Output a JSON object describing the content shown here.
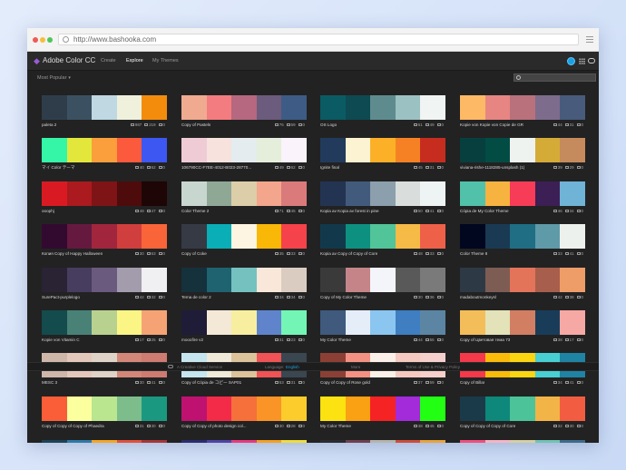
{
  "browser": {
    "url": "http://www.bashooka.com"
  },
  "app": {
    "title": "Adobe Color CC",
    "nav": [
      "Create",
      "Explore",
      "My Themes"
    ],
    "active_nav": "Explore",
    "sort_label": "Most Popular",
    "search_placeholder": ""
  },
  "footer": {
    "creative_cloud": "A Creative Cloud Service",
    "language_label": "Language:",
    "language_value": "English",
    "more": "More",
    "legal": "Terms of Use  &  Privacy Policy"
  },
  "themes": [
    {
      "name": "paleta 2",
      "views": "987",
      "likes": "219",
      "comments": "0",
      "colors": [
        "#2f3d4a",
        "#3b5162",
        "#bfd8e1",
        "#eff1dc",
        "#f38c0c"
      ]
    },
    {
      "name": "Copy of Pastels",
      "views": "76",
      "likes": "59",
      "comments": "0",
      "colors": [
        "#f0aa90",
        "#f37c80",
        "#b5687f",
        "#6b5b7c",
        "#3d5b85"
      ]
    },
    {
      "name": "OS Logo",
      "views": "61",
      "likes": "49",
      "comments": "0",
      "colors": [
        "#0a5b64",
        "#0e4a52",
        "#5e8c8e",
        "#9cc1c3",
        "#f0f4f2"
      ]
    },
    {
      "name": "Kopie von Kopie von Copie de GR",
      "views": "44",
      "likes": "31",
      "comments": "0",
      "colors": [
        "#fdb966",
        "#e78582",
        "#b9717c",
        "#7e6c8c",
        "#485b7d"
      ]
    },
    {
      "name": "マイ Color テーマ",
      "views": "40",
      "likes": "62",
      "comments": "0",
      "colors": [
        "#35f5a6",
        "#e3e73c",
        "#fb9f3c",
        "#fb5a3c",
        "#3d57f3"
      ]
    },
    {
      "name": "106790CC-F7EE-4012-B023-28770...",
      "views": "49",
      "likes": "62",
      "comments": "0",
      "colors": [
        "#efcbd6",
        "#f7e2dd",
        "#e4ecef",
        "#e5eedb",
        "#faf3fb"
      ]
    },
    {
      "name": "Ignite final",
      "views": "45",
      "likes": "31",
      "comments": "0",
      "colors": [
        "#223b5c",
        "#fbf3d1",
        "#fbb028",
        "#f68124",
        "#c62d1f"
      ]
    },
    {
      "name": "viviana-rishe-1118285-unsplash (1)",
      "views": "39",
      "likes": "29",
      "comments": "0",
      "colors": [
        "#073f3f",
        "#034c44",
        "#eef3ef",
        "#d5ab38",
        "#c58b5c"
      ]
    },
    {
      "name": "ooophj",
      "views": "48",
      "likes": "47",
      "comments": "0",
      "colors": [
        "#da1a22",
        "#aa1a1e",
        "#7e1416",
        "#4e0b0c",
        "#1d0605"
      ]
    },
    {
      "name": "Color Theme 2",
      "views": "71",
      "likes": "45",
      "comments": "0",
      "colors": [
        "#c7d7d0",
        "#8fa896",
        "#dccea9",
        "#f3a68c",
        "#da7a7b"
      ]
    },
    {
      "name": "Kopia av Kopia av forest in pine",
      "views": "50",
      "likes": "41",
      "comments": "0",
      "colors": [
        "#233452",
        "#425b7d",
        "#8c9fac",
        "#d9dedc",
        "#eef3f3"
      ]
    },
    {
      "name": "Cópia de My Color Theme",
      "views": "46",
      "likes": "34",
      "comments": "0",
      "colors": [
        "#52c1aa",
        "#f7b340",
        "#f63c57",
        "#3c1f54",
        "#6fb3d7"
      ]
    },
    {
      "name": "Копия Copy of Happy Halloween",
      "views": "30",
      "likes": "63",
      "comments": "0",
      "colors": [
        "#320a30",
        "#66193f",
        "#a1263d",
        "#d03f3d",
        "#fa6439"
      ]
    },
    {
      "name": "Copy of Coke",
      "views": "35",
      "likes": "33",
      "comments": "0",
      "colors": [
        "#353a45",
        "#0aaeb6",
        "#fdf5e1",
        "#f9b807",
        "#f6424a"
      ]
    },
    {
      "name": "Kopia av Copy of Copy of Core",
      "views": "48",
      "likes": "33",
      "comments": "0",
      "colors": [
        "#12394b",
        "#0e9080",
        "#52c499",
        "#f6ba47",
        "#ef6049"
      ]
    },
    {
      "name": "Color Theme 8",
      "views": "33",
      "likes": "41",
      "comments": "0",
      "colors": [
        "#01071e",
        "#1a3a53",
        "#1f6e83",
        "#5f9aa9",
        "#edf1ee"
      ]
    },
    {
      "name": "SurePact-purplelogo",
      "views": "42",
      "likes": "32",
      "comments": "0",
      "colors": [
        "#2a2334",
        "#473d5e",
        "#6a5a7d",
        "#a39cad",
        "#f0eff1"
      ]
    },
    {
      "name": "Tema de color 2",
      "views": "34",
      "likes": "34",
      "comments": "0",
      "colors": [
        "#14313c",
        "#1f6270",
        "#74c1bf",
        "#f9e8da",
        "#dbccc1"
      ]
    },
    {
      "name": "Copy of My Color Theme",
      "views": "30",
      "likes": "36",
      "comments": "0",
      "colors": [
        "#3a3a3a",
        "#c58588",
        "#f3f5fb",
        "#595959",
        "#7a7a7a"
      ]
    },
    {
      "name": "madaboutmonkeysl",
      "views": "42",
      "likes": "38",
      "comments": "0",
      "colors": [
        "#2d3a45",
        "#7d5c54",
        "#e3745a",
        "#a75e4c",
        "#ef9d68"
      ]
    },
    {
      "name": "Kopie von Vitamin C",
      "views": "17",
      "likes": "25",
      "comments": "0",
      "colors": [
        "#144b4c",
        "#498176",
        "#b9d18f",
        "#fbf585",
        "#f5a374"
      ]
    },
    {
      "name": "mooofire v2",
      "views": "31",
      "likes": "23",
      "comments": "0",
      "colors": [
        "#1f1c38",
        "#f3e9d6",
        "#f8ee9f",
        "#5f84cb",
        "#73f5b6"
      ]
    },
    {
      "name": "My Color Theme",
      "views": "44",
      "likes": "55",
      "comments": "0",
      "colors": [
        "#3f5a7d",
        "#e4edf8",
        "#8ac6f0",
        "#3e7ec1",
        "#5b85a3"
      ]
    },
    {
      "name": "Copy of Цветовая тема 73",
      "views": "38",
      "likes": "17",
      "comments": "0",
      "colors": [
        "#f3bd5a",
        "#e3e2b8",
        "#d27e63",
        "#193d59",
        "#f6a9a4"
      ]
    },
    {
      "name": "MESC 3",
      "views": "30",
      "likes": "41",
      "comments": "0",
      "colors": [
        "#ceb6a9",
        "#e4c7bb",
        "#dfd2c7",
        "#d28779",
        "#ce7b71"
      ]
    },
    {
      "name": "Copy of Cópia de コピー SAP01",
      "views": "53",
      "likes": "31",
      "comments": "0",
      "colors": [
        "#c5e5ef",
        "#eee9d8",
        "#dcc39a",
        "#ef5355",
        "#3a4650"
      ]
    },
    {
      "name": "Copy of Copy of Rose gold",
      "views": "37",
      "likes": "59",
      "comments": "0",
      "colors": [
        "#8c4035",
        "#f39283",
        "#faf0e7",
        "#f6c9c0",
        "#f4cfcb"
      ]
    },
    {
      "name": "Copy of Billar",
      "views": "34",
      "likes": "41",
      "comments": "0",
      "colors": [
        "#f4394b",
        "#fbbb0a",
        "#fad511",
        "#48cfd3",
        "#1f83a4"
      ]
    },
    {
      "name": "Copy of Copy of Copy of Phaedra",
      "views": "31",
      "likes": "30",
      "comments": "0",
      "colors": [
        "#fa5e38",
        "#fbff9d",
        "#b9e68e",
        "#7dbd8b",
        "#1b9880"
      ]
    },
    {
      "name": "Copy of Copy of photo design col...",
      "views": "30",
      "likes": "28",
      "comments": "0",
      "colors": [
        "#bf1270",
        "#f32b49",
        "#f5703a",
        "#fa9426",
        "#fbcc2b"
      ]
    },
    {
      "name": "My Color Theme",
      "views": "38",
      "likes": "45",
      "comments": "0",
      "colors": [
        "#fbe210",
        "#f9a013",
        "#f52323",
        "#a32bd9",
        "#22ff13"
      ]
    },
    {
      "name": "Copy of Copy of Copy of Core",
      "views": "32",
      "likes": "30",
      "comments": "0",
      "colors": [
        "#1a3a49",
        "#0d887a",
        "#4cc399",
        "#f2b447",
        "#f25d42"
      ]
    },
    {
      "name": "",
      "views": "",
      "likes": "",
      "comments": "",
      "colors": [
        "#1d4256",
        "#2e79a6",
        "#f5a623",
        "#e2503a",
        "#a73538"
      ]
    },
    {
      "name": "",
      "views": "",
      "likes": "",
      "comments": "",
      "colors": [
        "#2b2c6e",
        "#4e43a3",
        "#e73a7d",
        "#f5a020",
        "#f0dc3a"
      ]
    },
    {
      "name": "",
      "views": "",
      "likes": "",
      "comments": "",
      "colors": [
        "#2c2a2f",
        "#6e3f4f",
        "#b5b5ad",
        "#ce4d3a",
        "#e7a33b"
      ]
    },
    {
      "name": "",
      "views": "",
      "likes": "",
      "comments": "",
      "colors": [
        "#ef4f7d",
        "#f7b4c4",
        "#d4d0a0",
        "#71c3b5",
        "#3e6b87"
      ]
    }
  ]
}
